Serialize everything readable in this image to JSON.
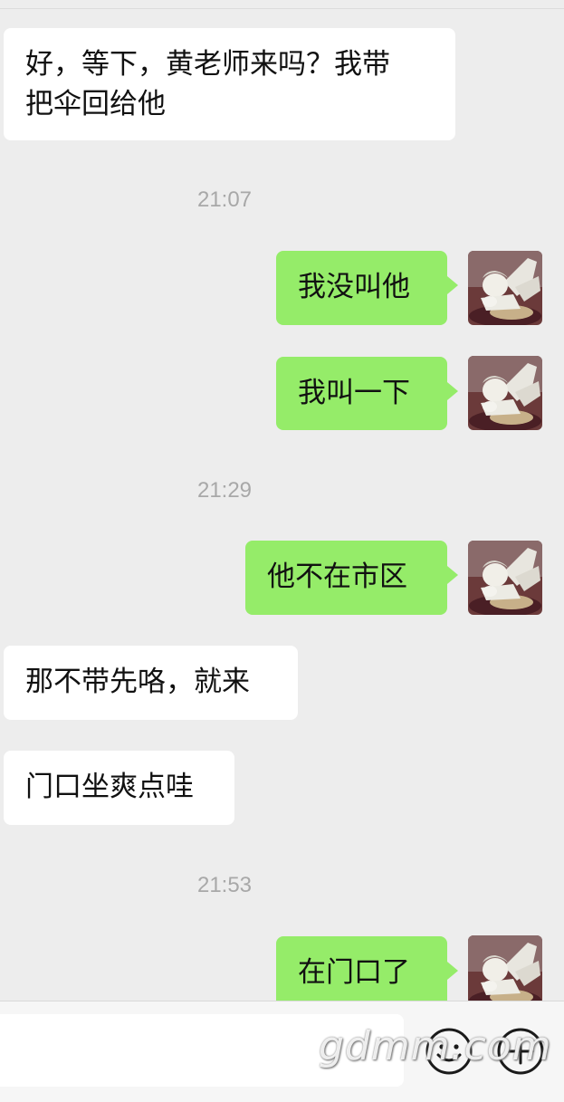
{
  "messages": [
    {
      "side": "in",
      "text": "好，等下，黄老师来吗？我带\n把伞回给他"
    },
    {
      "timestamp": "21:07"
    },
    {
      "side": "out",
      "text": "我没叫他"
    },
    {
      "side": "out",
      "text": "我叫一下"
    },
    {
      "timestamp": "21:29"
    },
    {
      "side": "out",
      "text": "他不在市区"
    },
    {
      "side": "in",
      "text": "那不带先咯，就来"
    },
    {
      "side": "in",
      "text": "门口坐爽点哇"
    },
    {
      "timestamp": "21:53"
    },
    {
      "side": "out",
      "text": "在门口了"
    }
  ],
  "m1": {
    "text": "好，等下，黄老师来吗？我带\n把伞回给他"
  },
  "t1": "21:07",
  "m2": {
    "text": "我没叫他"
  },
  "m3": {
    "text": "我叫一下"
  },
  "t2": "21:29",
  "m4": {
    "text": "他不在市区"
  },
  "m5": {
    "text": "那不带先咯，就来"
  },
  "m6": {
    "text": "门口坐爽点哇"
  },
  "t3": "21:53",
  "m7": {
    "text": "在门口了"
  },
  "input_bar": {
    "value": "",
    "emoji_icon": "emoji-icon",
    "plus_icon": "plus-icon"
  },
  "watermark": "gdmm.com",
  "colors": {
    "background": "#ededed",
    "incoming_bubble": "#ffffff",
    "outgoing_bubble": "#95ec69",
    "timestamp": "#a8a8a8"
  },
  "avatar_icon": "angel-statue-avatar"
}
